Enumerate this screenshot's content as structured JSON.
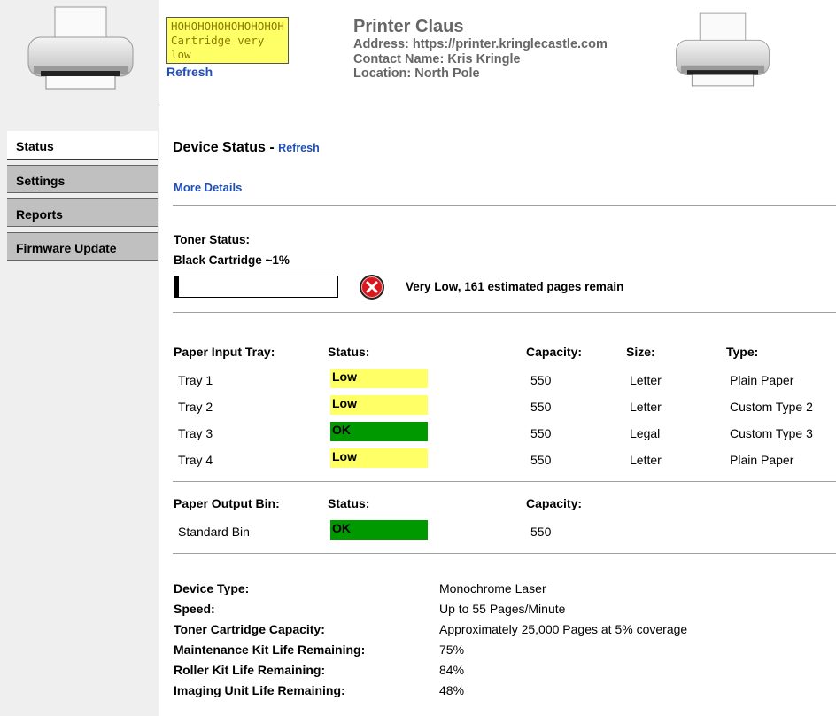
{
  "header": {
    "lcd_lines": [
      "HOHOHOHOHOHOHOHOH",
      "Cartridge very",
      "low"
    ],
    "lcd_refresh": "Refresh",
    "printer_name": "Printer Claus",
    "address": "Address: https://printer.kringlecastle.com",
    "contact": "Contact Name: Kris Kringle",
    "location": "Location: North Pole"
  },
  "sidebar": {
    "items": [
      {
        "label": "Status",
        "active": true
      },
      {
        "label": "Settings",
        "active": false
      },
      {
        "label": "Reports",
        "active": false
      },
      {
        "label": "Firmware Update",
        "active": false
      }
    ]
  },
  "device_status": {
    "title": "Device Status",
    "separator": "-",
    "refresh": "Refresh",
    "more_details": "More Details"
  },
  "toner": {
    "heading": "Toner Status:",
    "cartridge": "Black Cartridge ~1%",
    "level_percent": 1,
    "message": "Very Low, 161 estimated pages remain",
    "status_icon": "error-x-icon"
  },
  "input_trays": {
    "headers": [
      "Paper Input Tray:",
      "Status:",
      "Capacity:",
      "Size:",
      "Type:"
    ],
    "rows": [
      {
        "name": "Tray 1",
        "status": "Low",
        "status_color": "#ffff66",
        "capacity": "550",
        "size": "Letter",
        "type": "Plain Paper"
      },
      {
        "name": "Tray 2",
        "status": "Low",
        "status_color": "#ffff66",
        "capacity": "550",
        "size": "Letter",
        "type": "Custom Type 2"
      },
      {
        "name": "Tray 3",
        "status": "OK",
        "status_color": "#009900",
        "capacity": "550",
        "size": "Legal",
        "type": "Custom Type 3"
      },
      {
        "name": "Tray 4",
        "status": "Low",
        "status_color": "#ffff66",
        "capacity": "550",
        "size": "Letter",
        "type": "Plain Paper"
      }
    ]
  },
  "output_bin": {
    "headers": [
      "Paper Output Bin:",
      "Status:",
      "Capacity:"
    ],
    "rows": [
      {
        "name": "Standard Bin",
        "status": "OK",
        "status_color": "#009900",
        "capacity": "550"
      }
    ]
  },
  "device_info": [
    {
      "label": "Device Type:",
      "value": "Monochrome Laser"
    },
    {
      "label": "Speed:",
      "value": "Up to 55 Pages/Minute"
    },
    {
      "label": "Toner Cartridge Capacity:",
      "value": "Approximately 25,000 Pages at 5% coverage"
    },
    {
      "label": "Maintenance Kit Life Remaining:",
      "value": "75%"
    },
    {
      "label": "Roller Kit Life Remaining:",
      "value": "84%"
    },
    {
      "label": "Imaging Unit Life Remaining:",
      "value": "48%"
    }
  ]
}
